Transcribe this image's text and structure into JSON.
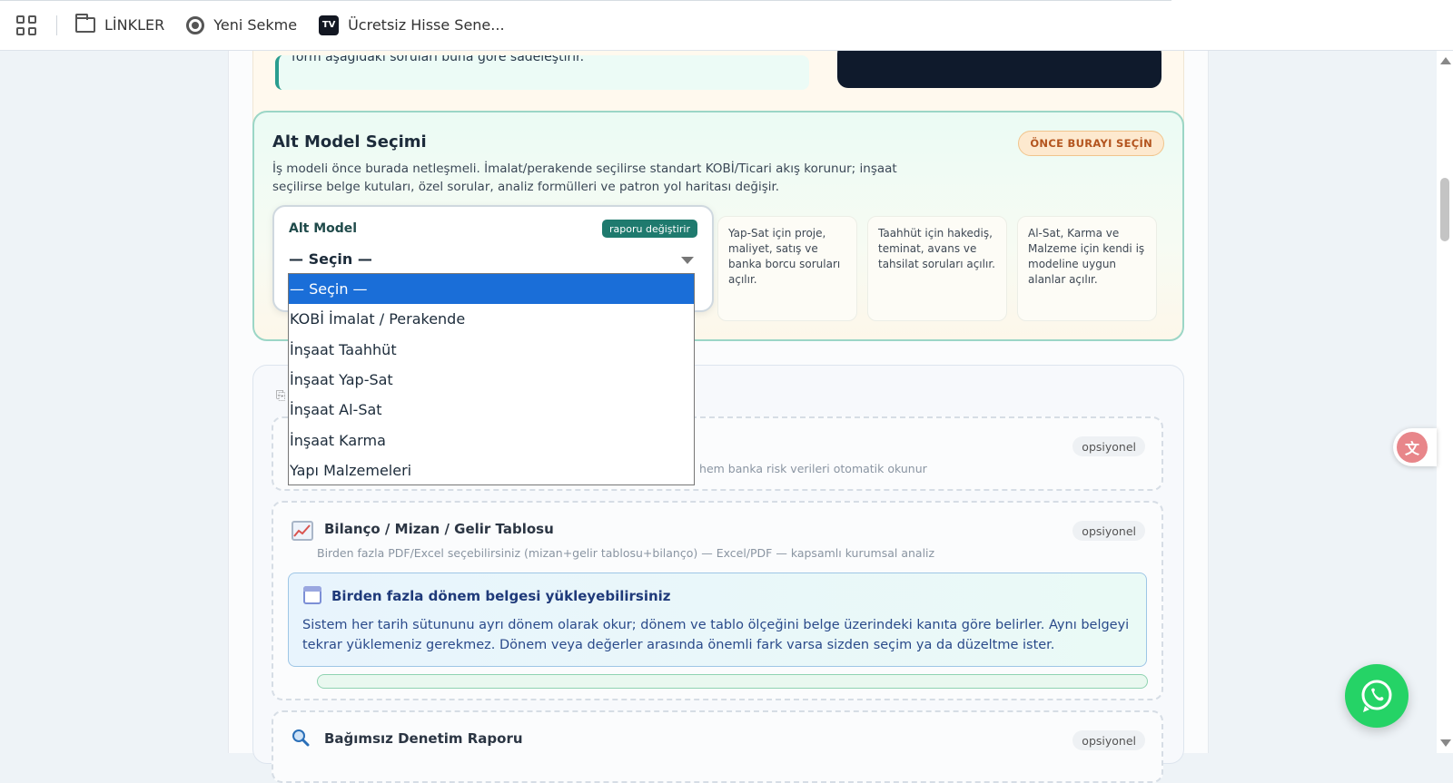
{
  "bookmarks": {
    "items": [
      {
        "label": "LİNKLER",
        "icon": "folder-icon"
      },
      {
        "label": "Yeni Sekme",
        "icon": "chrome-icon"
      },
      {
        "label": "Ücretsiz Hisse Sene...",
        "icon": "tradingview-icon"
      }
    ]
  },
  "top_card": {
    "note": "form aşağıdaki soruları buna göre sadeleştirir."
  },
  "alt_model": {
    "title": "Alt Model Seçimi",
    "badge": "ÖNCE BURAYI SEÇİN",
    "description": "İş modeli önce burada netleşmeli. İmalat/perakende seçilirse standart KOBİ/Ticari akış korunur; inşaat seçilirse belge kutuları, özel sorular, analiz formülleri ve patron yol haritası değişir.",
    "select_label": "Alt Model",
    "select_chip": "raporu değiştirir",
    "selected_value": "— Seçin —",
    "info_cards": [
      "Yap-Sat için proje, maliyet, satış ve banka borcu soruları açılır.",
      "Taahhüt için hakediş, teminat, avans ve tahsilat soruları açılır.",
      "Al-Sat, Karma ve Malzeme için kendi iş modeline uygun alanlar açılır."
    ],
    "options": [
      "— Seçin —",
      "KOBİ İmalat / Perakende",
      "İnşaat Taahhüt",
      "İnşaat Yap-Sat",
      "İnşaat Al-Sat",
      "İnşaat Karma",
      "Yapı Malzemeleri"
    ]
  },
  "uploads": {
    "first_drop": {
      "optional": "opsiyonel",
      "sub": "ru hem banka risk verileri otomatik okunur"
    },
    "balance": {
      "title": "Bilanço / Mizan / Gelir Tablosu",
      "optional": "opsiyonel",
      "sub": "Birden fazla PDF/Excel seçebilirsiniz (mizan+gelir tablosu+bilanço) — Excel/PDF — kapsamlı kurumsal analiz",
      "info_title": "Birden fazla dönem belgesi yükleyebilirsiniz",
      "info_text": "Sistem her tarih sütununu ayrı dönem olarak okur; dönem ve tablo ölçeğini belge üzerindeki kanıta göre belirler. Aynı belgeyi tekrar yüklemeniz gerekmez. Dönem veya değerler arasında önemli fark varsa sizden seçim ya da düzeltme ister."
    },
    "audit": {
      "title": "Bağımsız Denetim Raporu",
      "optional": "opsiyonel"
    }
  }
}
